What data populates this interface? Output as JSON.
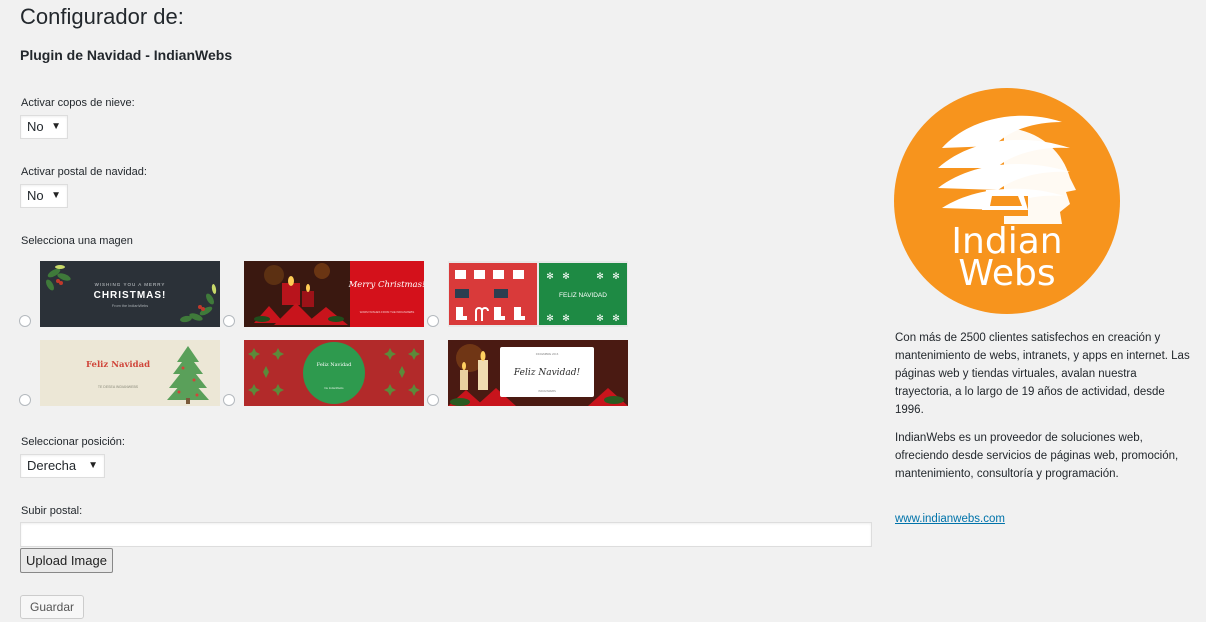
{
  "page": {
    "title": "Configurador de:",
    "subtitle": "Plugin de Navidad - IndianWebs"
  },
  "snow": {
    "label": "Activar copos de nieve:",
    "value": "No"
  },
  "postal": {
    "label": "Activar postal de navidad:",
    "value": "No"
  },
  "images": {
    "label": "Selecciona una magen",
    "cards": [
      {
        "title": "CHRISTMAS!",
        "top": "WISHING YOU A MERRY",
        "bottom": "From the IndianWebs"
      },
      {
        "title": "Merry Christmas!",
        "bottom": "WARM WISHES FROM THE INDIANWEBS"
      },
      {
        "title": "FELIZ NAVIDAD"
      },
      {
        "title": "Feliz Navidad",
        "bottom": "TE DESEA INDIANWEBS"
      },
      {
        "title": "Feliz Navidad",
        "bottom": "De IndianWebs"
      },
      {
        "title": "Feliz Navidad!",
        "top": "DICIEMBRE 2016",
        "bottom": "INDIANWEBS"
      }
    ]
  },
  "position": {
    "label": "Seleccionar posición:",
    "value": "Derecha"
  },
  "upload": {
    "label": "Subir postal:",
    "button": "Upload Image",
    "value": ""
  },
  "save": {
    "button": "Guardar"
  },
  "sidebar": {
    "logo_line1": "Indian",
    "logo_line2": "Webs",
    "paragraph1": "Con más de 2500 clientes satisfechos en creación y mantenimiento de webs, intranets, y apps en internet. Las páginas web y tiendas virtuales, avalan nuestra trayectoria, a lo largo de 19 años de actividad, desde 1996.",
    "paragraph2": "IndianWebs es un proveedor de soluciones web, ofreciendo desde servicios de páginas web, promoción, mantenimiento, consultoría y programación.",
    "link": "www.indianwebs.com"
  },
  "colors": {
    "brand_orange": "#f7941d",
    "link": "#0073aa"
  },
  "icons": {
    "dropdown": "chevron-down-icon",
    "logo": "indian-head-logo-icon"
  }
}
